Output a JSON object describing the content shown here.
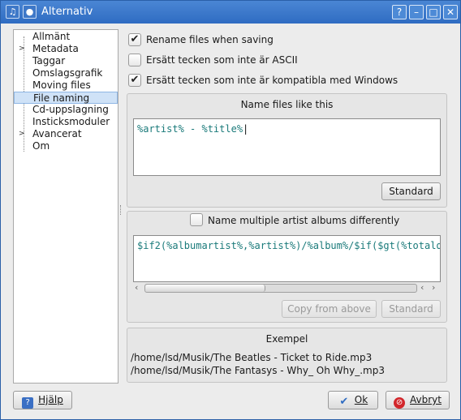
{
  "window": {
    "title": "Alternativ",
    "help_btn": "?",
    "minimize_btn": "–",
    "maximize_btn": "□",
    "close_btn": "✕"
  },
  "sidebar": {
    "items": [
      {
        "label": "Allmänt",
        "expandable": false
      },
      {
        "label": "Metadata",
        "expandable": true
      },
      {
        "label": "Taggar",
        "expandable": false
      },
      {
        "label": "Omslagsgrafik",
        "expandable": false
      },
      {
        "label": "Moving files",
        "expandable": false
      },
      {
        "label": "File naming",
        "expandable": false,
        "selected": true
      },
      {
        "label": "Cd-uppslagning",
        "expandable": false
      },
      {
        "label": "Insticksmoduler",
        "expandable": false
      },
      {
        "label": "Avancerat",
        "expandable": true
      },
      {
        "label": "Om",
        "expandable": false
      }
    ]
  },
  "options": {
    "rename_files": {
      "label": "Rename files when saving",
      "checked": true
    },
    "replace_non_ascii": {
      "label": "Ersätt tecken som inte är ASCII",
      "checked": false
    },
    "replace_windows": {
      "label": "Ersätt tecken som inte är kompatibla med Windows",
      "checked": true
    }
  },
  "naming": {
    "title": "Name files like this",
    "value": "%artist% - %title%",
    "default_btn": "Standard"
  },
  "multi_artist": {
    "label": "Name multiple artist albums differently",
    "checked": false,
    "value": "$if2(%albumartist%,%artist%)/%album%/$if($gt(%totald",
    "copy_btn": "Copy from above",
    "default_btn": "Standard"
  },
  "example": {
    "title": "Exempel",
    "lines": [
      "/home/lsd/Musik/The Beatles - Ticket to Ride.mp3",
      "/home/lsd/Musik/The Fantasys - Why_ Oh Why_.mp3"
    ]
  },
  "footer": {
    "help_btn": "Hjälp",
    "ok_btn": "Ok",
    "cancel_btn": "Avbryt"
  },
  "colors": {
    "accent": "#2f6cc2",
    "selection": "#cfe2f7",
    "variable_text": "#1a7a7a",
    "function_text": "#2a3fbf"
  }
}
